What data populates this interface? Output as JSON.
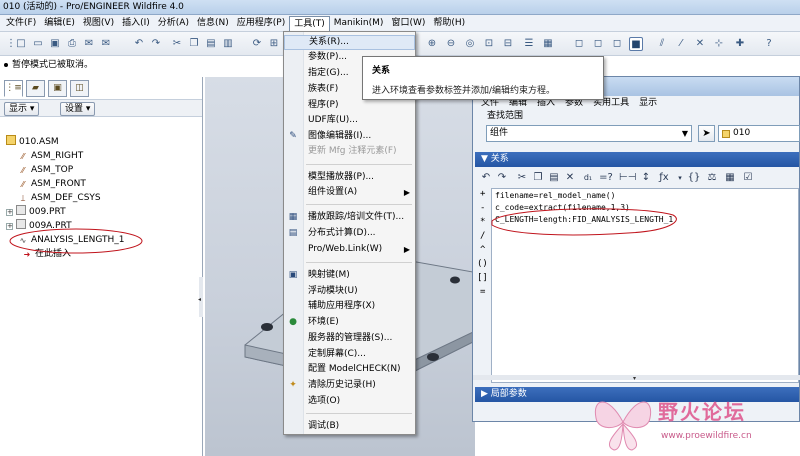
{
  "window": {
    "title": "010 (活动的) - Pro/ENGINEER Wildfire 4.0"
  },
  "menubar": {
    "items": [
      "文件(F)",
      "编辑(E)",
      "视图(V)",
      "插入(I)",
      "分析(A)",
      "信息(N)",
      "应用程序(P)",
      "工具(T)",
      "Manikin(M)",
      "窗口(W)",
      "帮助(H)"
    ],
    "active_index": 7
  },
  "status": {
    "message": "暂停模式已被取消。"
  },
  "left_panel": {
    "display_button": "显示",
    "settings_button": "设置",
    "tree": [
      {
        "label": "010.ASM",
        "icon": "assembly-icon"
      },
      {
        "label": "ASM_RIGHT",
        "icon": "datum-plane-icon"
      },
      {
        "label": "ASM_TOP",
        "icon": "datum-plane-icon"
      },
      {
        "label": "ASM_FRONT",
        "icon": "datum-plane-icon"
      },
      {
        "label": "ASM_DEF_CSYS",
        "icon": "csys-icon"
      },
      {
        "label": "009.PRT",
        "icon": "part-icon"
      },
      {
        "label": "009A.PRT",
        "icon": "part-icon"
      },
      {
        "label": "ANALYSIS_LENGTH_1",
        "icon": "analysis-icon"
      },
      {
        "label": "在此插入",
        "icon": "insert-here-icon"
      }
    ]
  },
  "tools_menu": {
    "items": [
      {
        "label": "关系(R)...",
        "highlighted": true
      },
      {
        "label": "参数(P)..."
      },
      {
        "label": "指定(G)..."
      },
      {
        "label": "族表(F)"
      },
      {
        "label": "程序(P)"
      },
      {
        "label": "UDF库(U)..."
      },
      {
        "label": "图像编辑器(I)...",
        "icon": "image-editor-icon"
      },
      {
        "label": "更新 Mfg 注释元素(F)",
        "disabled": true
      },
      {
        "label": "模型播放器(P)..."
      },
      {
        "label": "组件设置(A)",
        "submenu": true
      },
      {
        "label": "播放跟踪/培训文件(T)...",
        "icon": "trail-file-icon"
      },
      {
        "label": "分布式计算(D)...",
        "icon": "distributed-computing-icon"
      },
      {
        "label": "Pro/Web.Link(W)",
        "submenu": true
      },
      {
        "label": "映射键(M)",
        "icon": "mapkey-icon"
      },
      {
        "label": "浮动模块(U)"
      },
      {
        "label": "辅助应用程序(X)"
      },
      {
        "label": "环境(E)",
        "icon": "environment-icon"
      },
      {
        "label": "服务器的管理器(S)..."
      },
      {
        "label": "定制屏幕(C)..."
      },
      {
        "label": "配置 ModelCHECK(N)"
      },
      {
        "label": "清除历史记录(H)",
        "icon": "clear-history-icon"
      },
      {
        "label": "选项(O)"
      },
      {
        "label": "调试(B)"
      }
    ]
  },
  "tooltip": {
    "title": "关系",
    "description": "进入环境查看参数标签并添加/编辑约束方程。"
  },
  "relations_dialog": {
    "menu": [
      "文件",
      "编辑",
      "插入",
      "参数",
      "实用工具",
      "显示"
    ],
    "scope_label": "查找范围",
    "scope_value": "组件",
    "target": "010",
    "section_title": "关系",
    "operators": [
      "+",
      "-",
      "*",
      "/",
      "^",
      "()",
      "[]",
      "="
    ],
    "lines": [
      "filename=rel_model_name()",
      "c_code=extract(filename,1,3)",
      "C_LENGTH=length:FID_ANALYSIS_LENGTH_1"
    ],
    "local_params_title": "局部参数"
  },
  "watermark": {
    "text": "野火论坛",
    "url": "www.proewildfire.cn"
  },
  "colors": {
    "section_header": "#2d5fae",
    "menu_highlight": "#dfe9f6",
    "annotation_red": "#c0141c",
    "watermark_pink": "#e06a9b"
  }
}
